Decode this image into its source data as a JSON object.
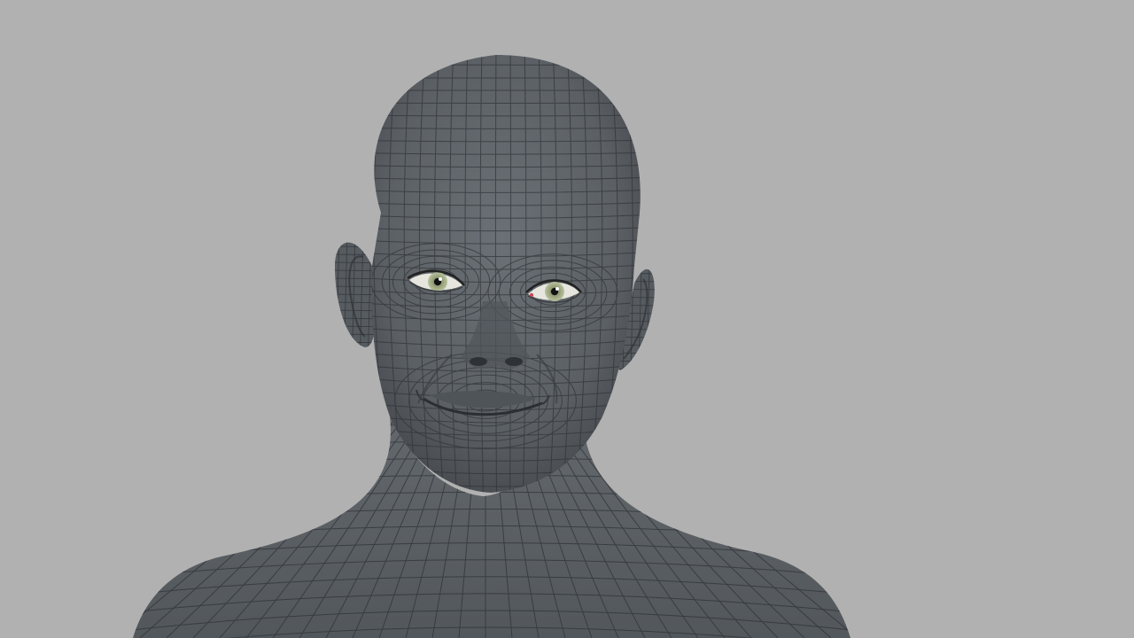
{
  "scene": {
    "background_color": "#b1b1b1",
    "mesh_color": "#5c6166",
    "mesh_shadow_color": "#454a4f",
    "wire_color": "#2f3337",
    "eye_iris_color": "#a7b28a",
    "eye_pupil_color": "#111111"
  },
  "subject": {
    "object": "head-and-shoulders-mesh",
    "rendering": "wireframe-overlay",
    "expression": "smile"
  }
}
